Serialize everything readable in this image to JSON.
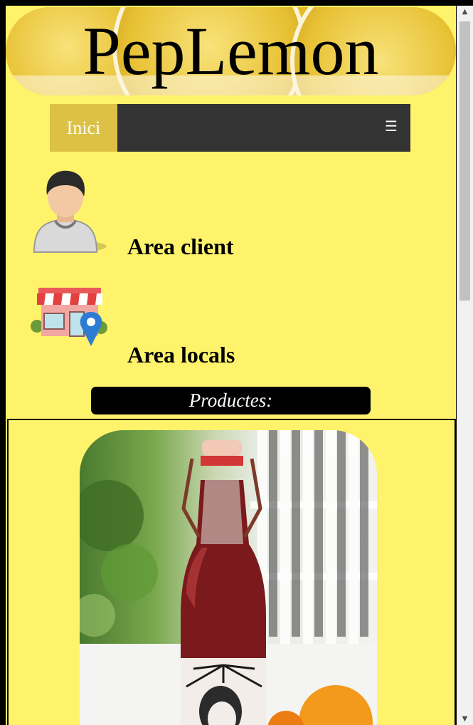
{
  "banner": {
    "title": "PepLemon"
  },
  "nav": {
    "home_label": "Inici",
    "menu_icon": "☰"
  },
  "areas": [
    {
      "label": "Area client",
      "icon": "user-avatar-icon"
    },
    {
      "label": "Area locals",
      "icon": "shop-location-icon"
    }
  ],
  "products": {
    "heading": "Productes:"
  },
  "colors": {
    "page_background": "#fff36b",
    "nav_background": "#333333",
    "nav_active": "#dcc146",
    "productes_bar": "#000000"
  }
}
